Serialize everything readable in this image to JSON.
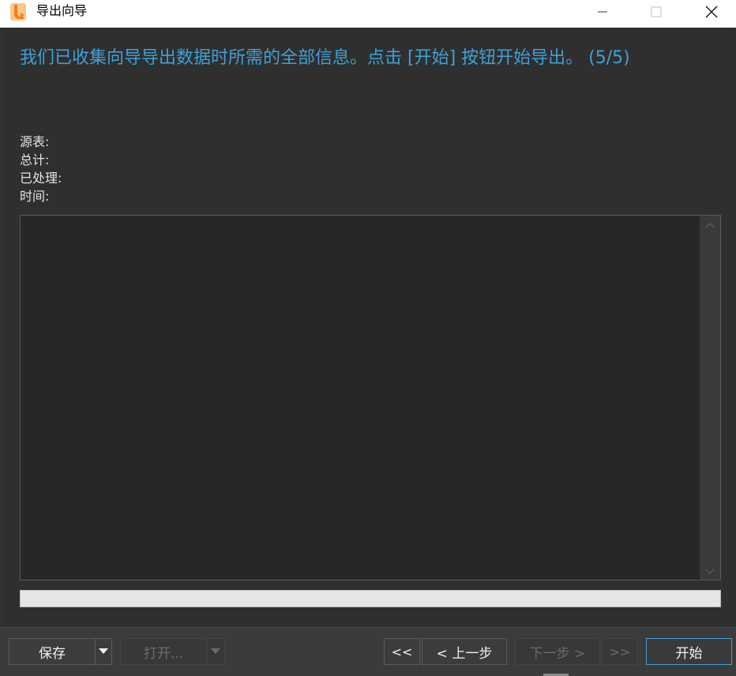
{
  "window": {
    "title": "导出向导",
    "minimize_icon": "minimize-icon",
    "maximize_icon": "maximize-icon",
    "close_icon": "close-icon",
    "app_icon": "navicat-app-icon"
  },
  "main": {
    "headline": "我们已收集向导导出数据时所需的全部信息。点击 [开始] 按钮开始导出。 (5/5)",
    "info": {
      "source_table_label": "源表:",
      "total_label": "总计:",
      "processed_label": "已处理:",
      "time_label": "时间:"
    },
    "log_text": "",
    "progress_fraction": 0
  },
  "footer": {
    "save_label": "保存",
    "open_label": "打开...",
    "first_label": "<<",
    "prev_label": "< 上一步",
    "next_label": "下一步 >",
    "last_label": ">>",
    "start_label": "开始"
  },
  "colors": {
    "accent": "#3fa0d8",
    "background": "#2f2f2f",
    "titlebar": "#ffffff"
  }
}
